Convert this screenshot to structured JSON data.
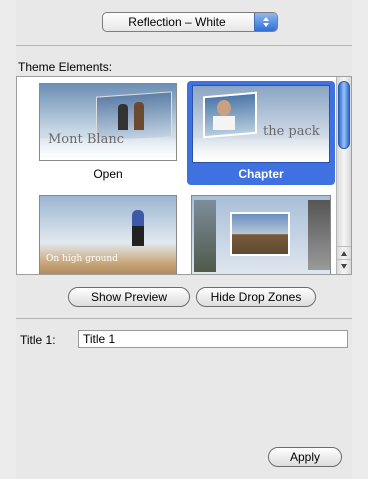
{
  "theme_popup": {
    "selected": "Reflection – White"
  },
  "section": {
    "label": "Theme Elements:"
  },
  "thumbnails": [
    {
      "label": "Open",
      "caption": "Mont Blanc",
      "selected": false
    },
    {
      "label": "Chapter",
      "caption": "the pack",
      "selected": true
    },
    {
      "label": "",
      "caption": "On high ground",
      "selected": false
    },
    {
      "label": "",
      "caption": "",
      "selected": false
    }
  ],
  "buttons": {
    "show_preview": "Show Preview",
    "hide_drop_zones": "Hide Drop Zones",
    "apply": "Apply"
  },
  "title_field": {
    "label": "Title 1:",
    "value": "Title 1"
  },
  "colors": {
    "selection": "#3f72e0",
    "scroll_accent": "#2c68d3"
  }
}
